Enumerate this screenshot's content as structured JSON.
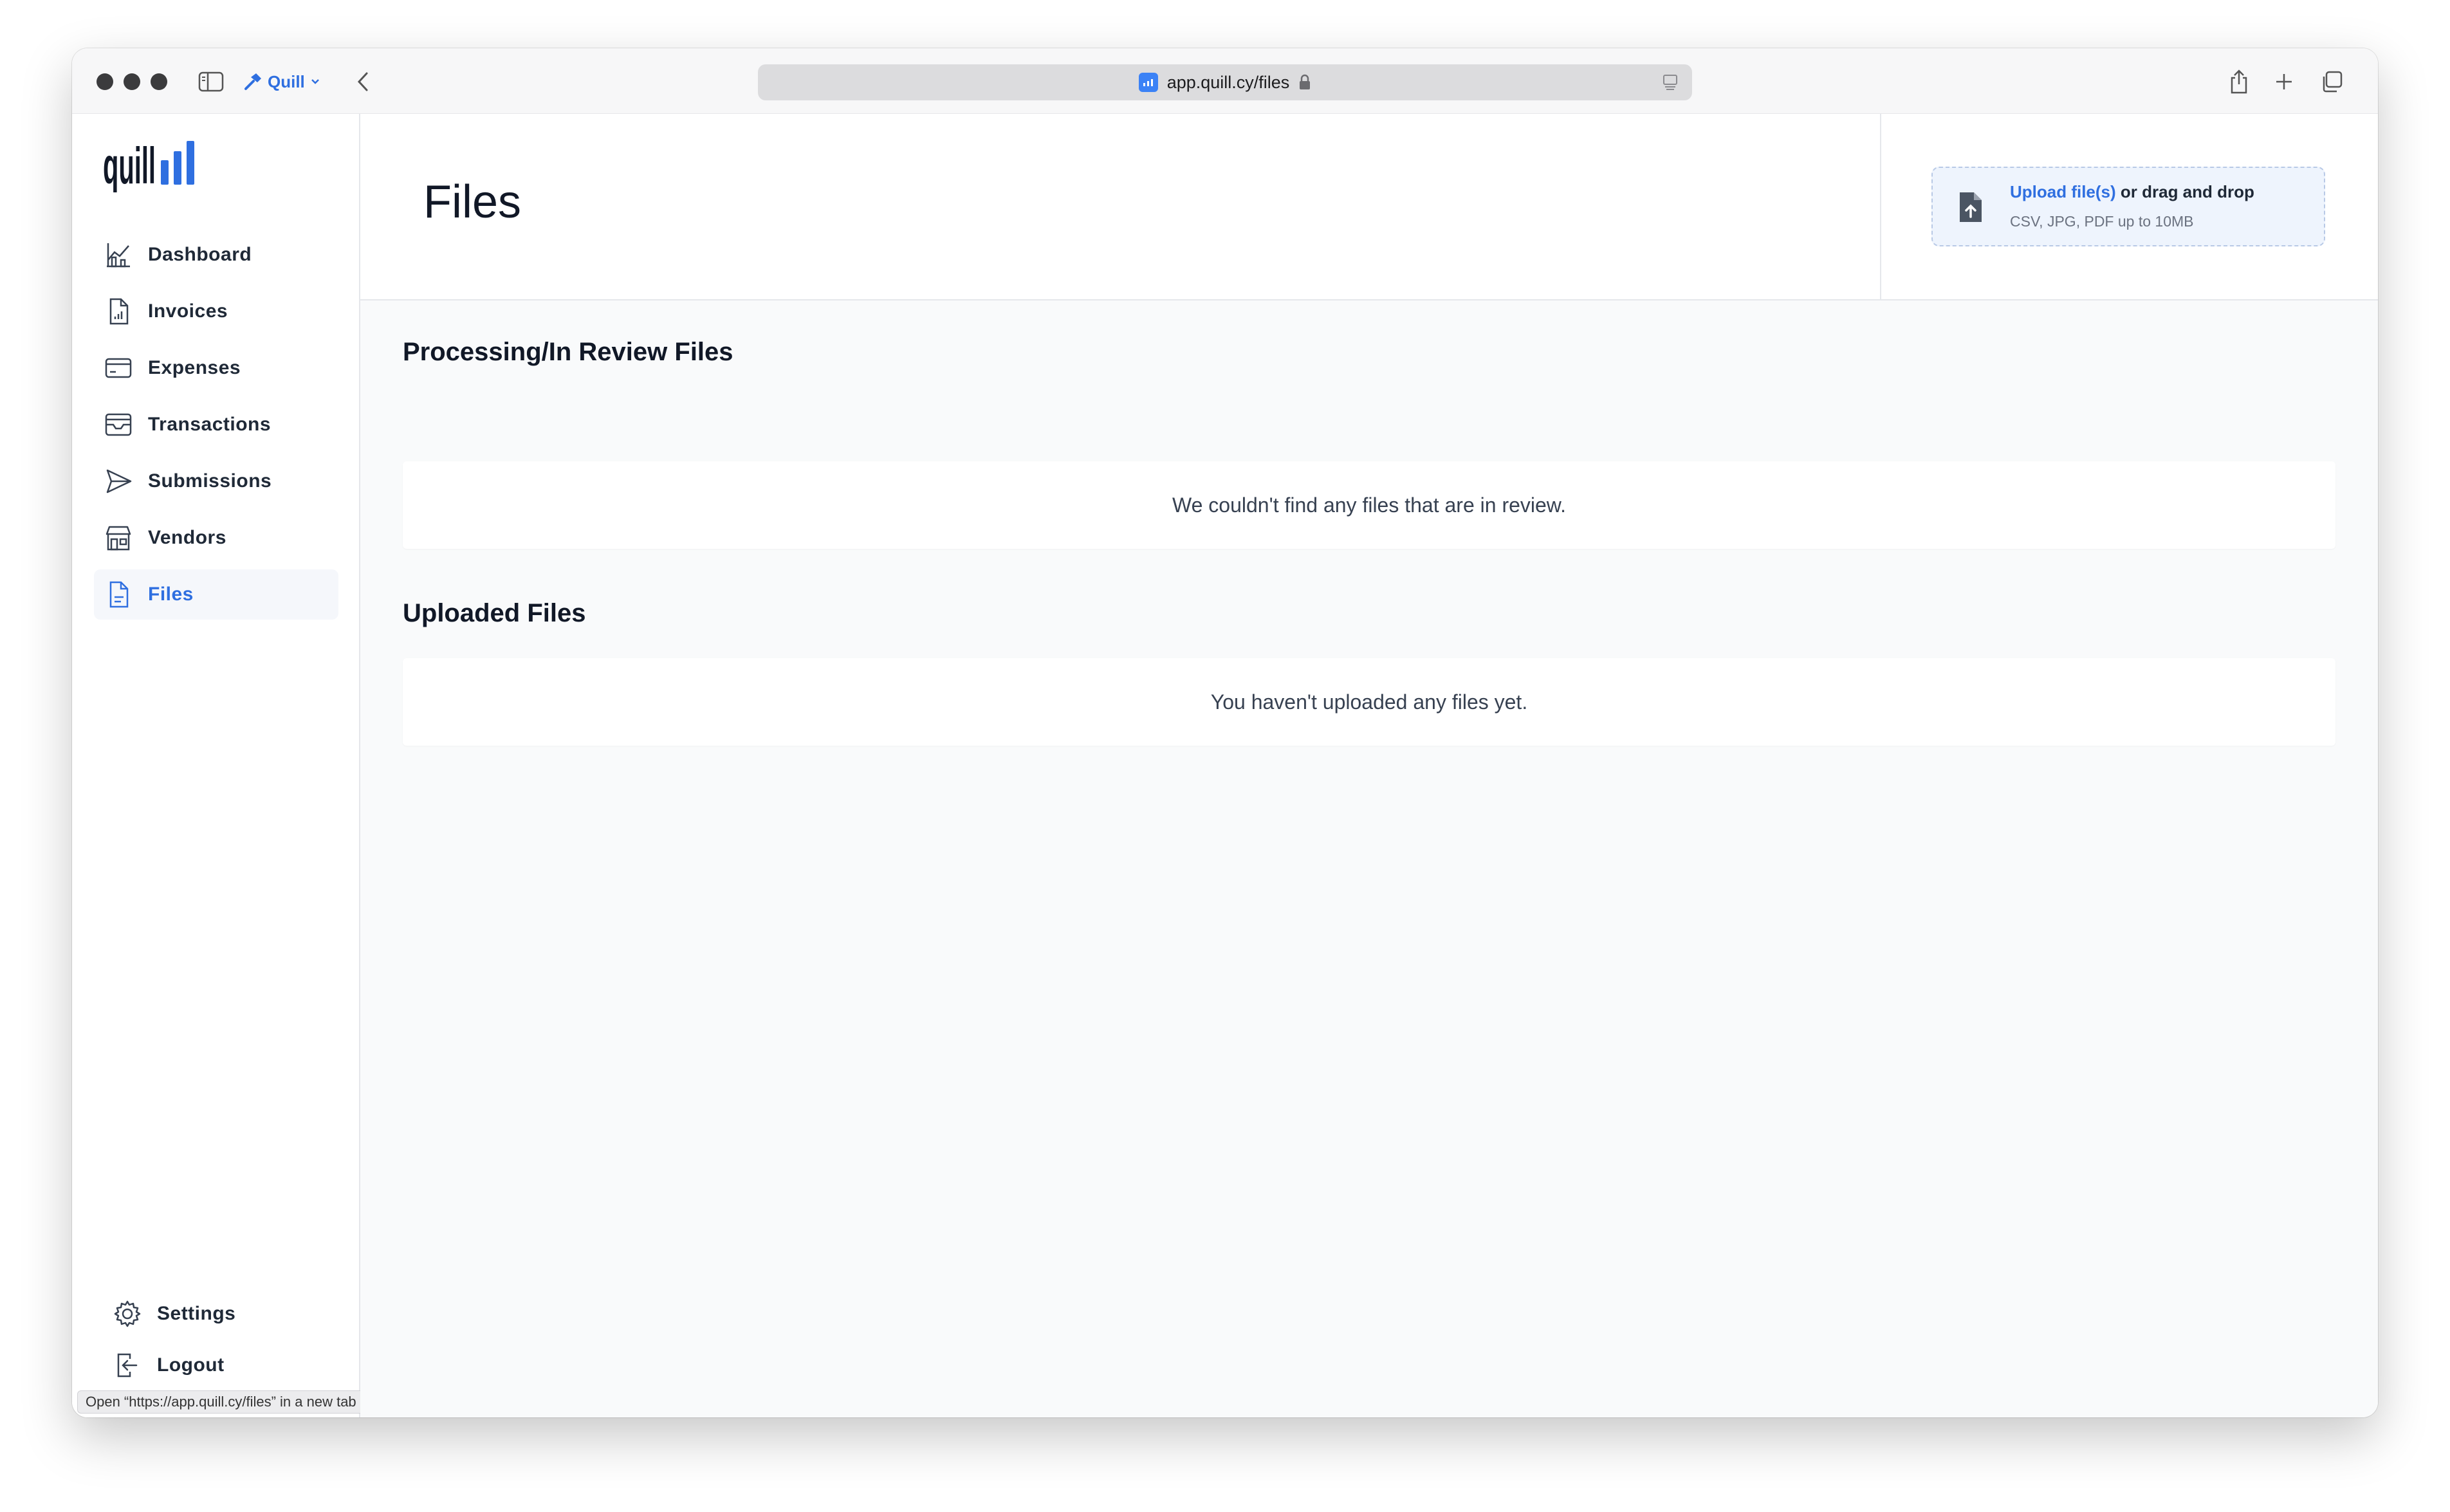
{
  "browser": {
    "profile_label": "Quill",
    "address": "app.quill.cy/files",
    "status_tip": "Open “https://app.quill.cy/files” in a new tab"
  },
  "sidebar": {
    "logo_text": "quill",
    "items": [
      {
        "label": "Dashboard",
        "icon": "dashboard-chart-icon"
      },
      {
        "label": "Invoices",
        "icon": "invoice-document-icon"
      },
      {
        "label": "Expenses",
        "icon": "credit-card-icon"
      },
      {
        "label": "Transactions",
        "icon": "inbox-tray-icon"
      },
      {
        "label": "Submissions",
        "icon": "paper-plane-icon"
      },
      {
        "label": "Vendors",
        "icon": "storefront-icon"
      },
      {
        "label": "Files",
        "icon": "file-icon",
        "active": true
      }
    ],
    "bottom_items": [
      {
        "label": "Settings",
        "icon": "gear-icon"
      },
      {
        "label": "Logout",
        "icon": "logout-icon"
      }
    ]
  },
  "main": {
    "title": "Files",
    "upload": {
      "link_text": "Upload file(s)",
      "rest_text": " or drag and drop",
      "hint": "CSV, JPG, PDF up to 10MB"
    },
    "sections": [
      {
        "title": "Processing/In Review Files",
        "empty_text": "We couldn't find any files that are in review."
      },
      {
        "title": "Uploaded Files",
        "empty_text": "You haven't uploaded any files yet."
      }
    ]
  },
  "colors": {
    "accent": "#2f6fe0",
    "text": "#1f2937",
    "background": "#f9fafb"
  }
}
